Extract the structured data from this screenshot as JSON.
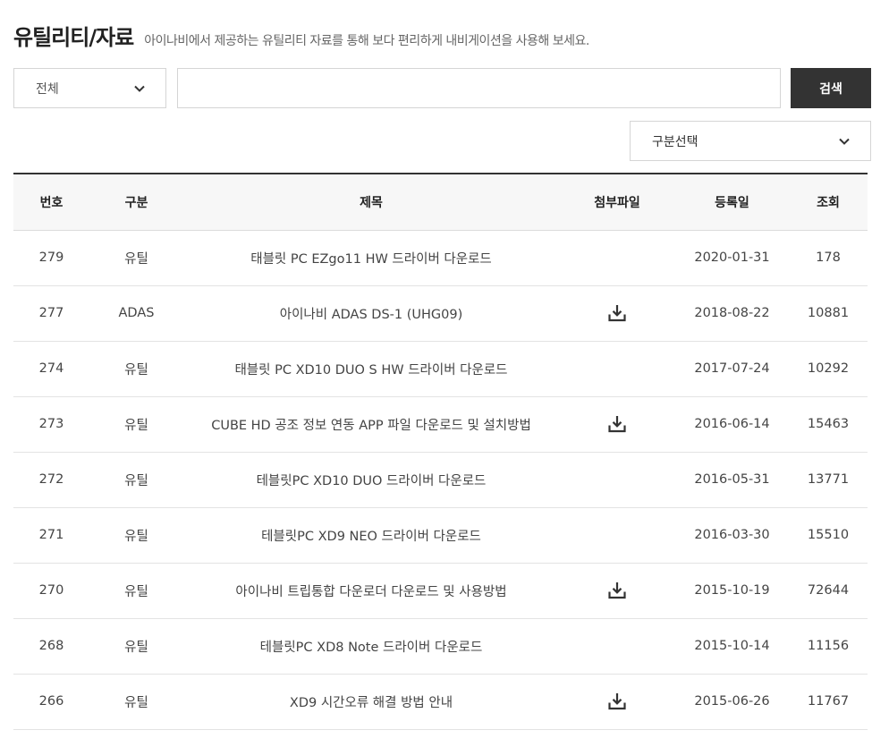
{
  "header": {
    "title": "유틸리티/자료",
    "description": "아이나비에서 제공하는 유틸리티 자료를 통해 보다 편리하게 내비게이션을 사용해 보세요."
  },
  "search": {
    "scope_value": "전체",
    "input_value": "",
    "input_placeholder": "",
    "button_label": "검색"
  },
  "filter": {
    "category_value": "구분선택"
  },
  "table": {
    "headers": [
      "번호",
      "구분",
      "제목",
      "첨부파일",
      "등록일",
      "조회"
    ],
    "rows": [
      {
        "no": "279",
        "category": "유틸",
        "title": "태블릿 PC EZgo11 HW 드라이버 다운로드",
        "attachment": false,
        "date": "2020-01-31",
        "views": "178"
      },
      {
        "no": "277",
        "category": "ADAS",
        "title": "아이나비 ADAS DS-1 (UHG09)",
        "attachment": true,
        "date": "2018-08-22",
        "views": "10881"
      },
      {
        "no": "274",
        "category": "유틸",
        "title": "태블릿 PC XD10 DUO S HW 드라이버 다운로드",
        "attachment": false,
        "date": "2017-07-24",
        "views": "10292"
      },
      {
        "no": "273",
        "category": "유틸",
        "title": "CUBE HD 공조 정보 연동 APP 파일 다운로드 및 설치방법",
        "attachment": true,
        "date": "2016-06-14",
        "views": "15463"
      },
      {
        "no": "272",
        "category": "유틸",
        "title": "테블릿PC XD10 DUO 드라이버 다운로드",
        "attachment": false,
        "date": "2016-05-31",
        "views": "13771"
      },
      {
        "no": "271",
        "category": "유틸",
        "title": "테블릿PC XD9 NEO 드라이버 다운로드",
        "attachment": false,
        "date": "2016-03-30",
        "views": "15510"
      },
      {
        "no": "270",
        "category": "유틸",
        "title": "아이나비 트립통합 다운로더 다운로드 및 사용방법",
        "attachment": true,
        "date": "2015-10-19",
        "views": "72644"
      },
      {
        "no": "268",
        "category": "유틸",
        "title": "테블릿PC XD8 Note 드라이버 다운로드",
        "attachment": false,
        "date": "2015-10-14",
        "views": "11156"
      },
      {
        "no": "266",
        "category": "유틸",
        "title": "XD9 시간오류 해결 방법 안내",
        "attachment": true,
        "date": "2015-06-26",
        "views": "11767"
      }
    ]
  },
  "icons": {
    "chevron": "chevron-down-icon",
    "attachment": "download-icon"
  },
  "colors": {
    "search_button_bg": "#333333",
    "header_row_bg": "#f7f7f7"
  }
}
